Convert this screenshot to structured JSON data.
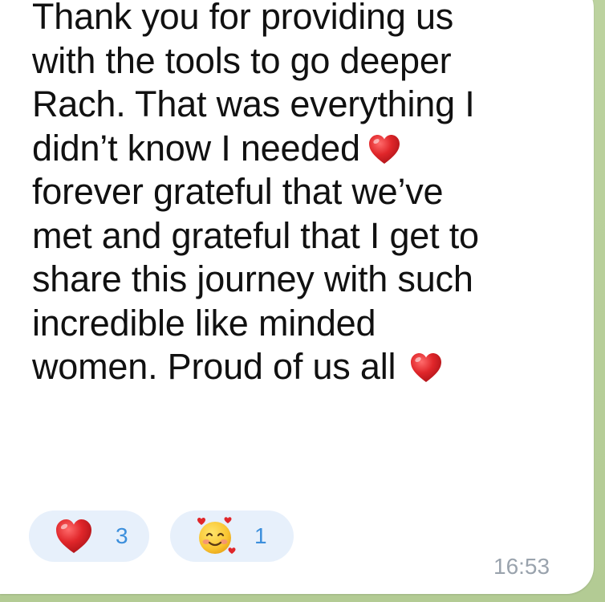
{
  "message": {
    "lines": [
      "Thank you for providing us",
      "with the tools to go deeper",
      "Rach. That was everything I",
      "didn’t know I needed",
      "forever grateful that we’ve",
      "met and grateful that I get to",
      "share this journey with such",
      "incredible like minded",
      "women. Proud of us all"
    ],
    "inline_emoji": "red-heart",
    "timestamp": "16:53"
  },
  "reactions": [
    {
      "emoji": "red-heart",
      "count": "3"
    },
    {
      "emoji": "smiling-face-with-hearts",
      "count": "1"
    }
  ],
  "colors": {
    "background": "#b9cf9c",
    "bubble": "#ffffff",
    "text": "#111111",
    "reaction_pill": "#e7f0fb",
    "reaction_count": "#3c8fdc",
    "timestamp": "#9aa3ad",
    "heart": "#e0262a"
  }
}
